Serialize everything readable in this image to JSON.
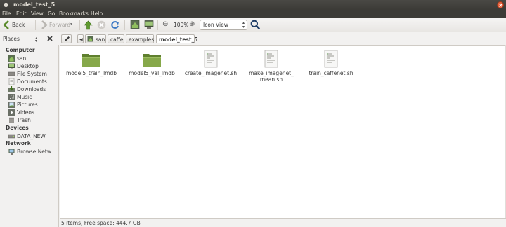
{
  "window": {
    "title": "model_test_5"
  },
  "menubar": {
    "items": [
      "File",
      "Edit",
      "View",
      "Go",
      "Bookmarks",
      "Help"
    ]
  },
  "toolbar": {
    "back_label": "Back",
    "forward_label": "Forward",
    "zoom_level": "100%",
    "view_mode": "Icon View"
  },
  "places": {
    "label": "Places"
  },
  "breadcrumb": [
    "san",
    "caffe",
    "examples",
    "model_test_5"
  ],
  "sidebar": {
    "computer": {
      "heading": "Computer",
      "items": [
        {
          "label": "san",
          "icon": "home-icon"
        },
        {
          "label": "Desktop",
          "icon": "desktop-icon"
        },
        {
          "label": "File System",
          "icon": "drive-icon"
        },
        {
          "label": "Documents",
          "icon": "documents-icon"
        },
        {
          "label": "Downloads",
          "icon": "downloads-icon"
        },
        {
          "label": "Music",
          "icon": "music-icon"
        },
        {
          "label": "Pictures",
          "icon": "pictures-icon"
        },
        {
          "label": "Videos",
          "icon": "videos-icon"
        },
        {
          "label": "Trash",
          "icon": "trash-icon"
        }
      ]
    },
    "devices": {
      "heading": "Devices",
      "items": [
        {
          "label": "DATA_NEW",
          "icon": "drive-icon"
        }
      ]
    },
    "network": {
      "heading": "Network",
      "items": [
        {
          "label": "Browse Netw…",
          "icon": "network-icon"
        }
      ]
    }
  },
  "files": [
    {
      "name": "model5_train_lmdb",
      "type": "folder"
    },
    {
      "name": "model5_val_lmdb",
      "type": "folder"
    },
    {
      "name": "create_imagenet.sh",
      "type": "script"
    },
    {
      "name": "make_imagenet_mean.sh",
      "type": "script",
      "display_lines": [
        "make_imagenet_",
        "mean.sh"
      ]
    },
    {
      "name": "train_caffenet.sh",
      "type": "script"
    }
  ],
  "status": {
    "text": "5 items, Free space: 444.7 GB"
  },
  "colors": {
    "folder_green": "#7a9a3e",
    "titlebar": "#3c3b37",
    "close_button": "#e8633e"
  }
}
